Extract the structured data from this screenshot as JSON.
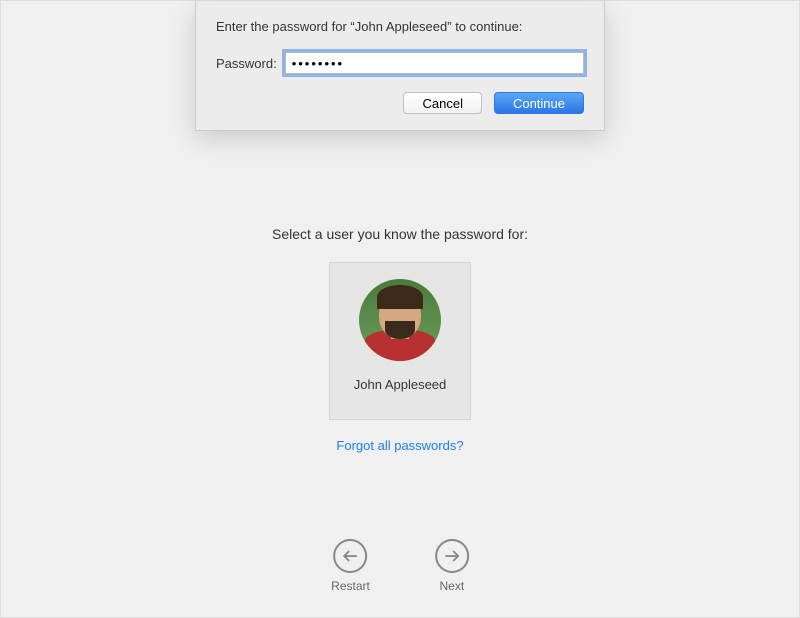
{
  "dialog": {
    "prompt": "Enter the password for “John Appleseed” to continue:",
    "password_label": "Password:",
    "password_value": "••••••••",
    "cancel_label": "Cancel",
    "continue_label": "Continue"
  },
  "main": {
    "select_prompt": "Select a user you know the password for:",
    "user_name": "John Appleseed",
    "forgot_link": "Forgot all passwords?"
  },
  "nav": {
    "restart_label": "Restart",
    "next_label": "Next"
  }
}
